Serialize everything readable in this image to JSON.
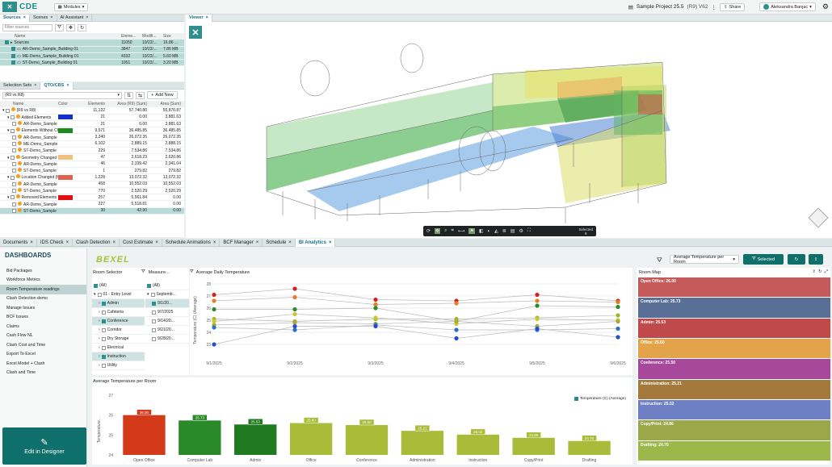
{
  "app": {
    "logo_text": "CDE",
    "modules_label": "Modules",
    "project": "Sample Project 25.5",
    "project_version": "(R9) V62",
    "share_label": "Share",
    "user": "Aleksandra Banjac"
  },
  "sources": {
    "tabs": [
      "Sources",
      "Scenes",
      "AI Assistant"
    ],
    "filter_placeholder": "Filter sources",
    "headers": [
      "Name",
      "Eleme...",
      "Modifi...",
      "Size"
    ],
    "rows": [
      {
        "name": "Sources",
        "elements": "11050",
        "modified": "10/22/...",
        "size": "16.86 ...",
        "sel": true
      },
      {
        "name": "AR-Demo_Sample_Building 01",
        "elements": "3847",
        "modified": "10/22/...",
        "size": "7.86 MB",
        "sel": true
      },
      {
        "name": "ME-Demo_Sample_Building 01",
        "elements": "4332",
        "modified": "10/22/...",
        "size": "5.60 MB",
        "sel": true
      },
      {
        "name": "ST-Demo_Sample_Building 01",
        "elements": "1051",
        "modified": "10/22/...",
        "size": "3.20 MB",
        "sel": true
      }
    ]
  },
  "selection": {
    "tabs": [
      "Selection Sets",
      "QTO/CBS"
    ],
    "version_select": "(R9 vs R8)",
    "add_new": "Add New",
    "headers": [
      "Name",
      "Color",
      "Elements",
      "Area (R9) (Sum)",
      "Area (Sum)"
    ],
    "rows": [
      {
        "name": "(R9 vs R8)",
        "color": "",
        "el": "11,122",
        "a1": "57,740.80",
        "a2": "55,870.87",
        "lvl": 0
      },
      {
        "name": "Added Elements",
        "color": "#1330c8",
        "el": "21",
        "a1": "0.00",
        "a2": "3,881.63",
        "lvl": 1
      },
      {
        "name": "AR-Demo_Sample",
        "color": "",
        "el": "21",
        "a1": "0.00",
        "a2": "3,881.63",
        "lvl": 2
      },
      {
        "name": "Elements Without Ch",
        "color": "#1c8a1c",
        "el": "9,571",
        "a1": "36,485.85",
        "a2": "36,485.85",
        "lvl": 1
      },
      {
        "name": "AR-Demo_Sample",
        "color": "",
        "el": "3,240",
        "a1": "26,072.35",
        "a2": "26,072.35",
        "lvl": 2
      },
      {
        "name": "ME-Demo_Sample",
        "color": "",
        "el": "6,102",
        "a1": "2,889.15",
        "a2": "2,888.15",
        "lvl": 2
      },
      {
        "name": "ST-Demo_Sample",
        "color": "",
        "el": "229",
        "a1": "7,534.86",
        "a2": "7,534.86",
        "lvl": 2
      },
      {
        "name": "Geometry Changed f",
        "color": "#f0c080",
        "el": "47",
        "a1": "2,618.23",
        "a2": "2,620.86",
        "lvl": 1
      },
      {
        "name": "AR-Demo_Sample",
        "color": "",
        "el": "46",
        "a1": "2,339.42",
        "a2": "2,341.04",
        "lvl": 2
      },
      {
        "name": "ST-Demo_Sample",
        "color": "",
        "el": "1",
        "a1": "279.82",
        "a2": "279.82",
        "lvl": 2
      },
      {
        "name": "Location Changed (fr",
        "color": "#e06050",
        "el": "1,228",
        "a1": "13,072.32",
        "a2": "13,072.32",
        "lvl": 1
      },
      {
        "name": "AR-Demo_Sample",
        "color": "",
        "el": "458",
        "a1": "10,552.03",
        "a2": "10,552.03",
        "lvl": 2
      },
      {
        "name": "ST-Demo_Sample",
        "color": "",
        "el": "770",
        "a1": "2,520.29",
        "a2": "2,520.29",
        "lvl": 2
      },
      {
        "name": "Removed Elements",
        "color": "#e01010",
        "el": "257",
        "a1": "5,561.84",
        "a2": "0.00",
        "lvl": 1
      },
      {
        "name": "AR-Demo_Sample",
        "color": "",
        "el": "227",
        "a1": "5,518.81",
        "a2": "0.00",
        "lvl": 2
      },
      {
        "name": "ST-Demo_Sample",
        "color": "",
        "el": "30",
        "a1": "42.90",
        "a2": "0.00",
        "lvl": 2
      }
    ]
  },
  "viewer": {
    "title": "Viewer",
    "selected_label": "Selected",
    "selected_count": "8"
  },
  "bottom_tabs": [
    "Documents",
    "IDS Check",
    "Clash Detection",
    "Cost Estimate",
    "Schedule Animations",
    "BCF Manager",
    "Schedule",
    "BI Analytics"
  ],
  "dashboards": {
    "title": "DASHBOARDS",
    "items": [
      "Bid Packages",
      "Workforce Metrics",
      "Room Temperature readings",
      "Clash Detection demo",
      "Manage Issues",
      "BCF Issues",
      "Claims",
      "Cash Flow NL",
      "Clash Cost and Time",
      "Export To Excel",
      "Excel Model + Clash",
      "Clash and Time"
    ],
    "active_index": 2,
    "edit_label": "Edit in Designer"
  },
  "bi": {
    "logo": "BEXEL",
    "measure_select": "Average Temperature per Room",
    "selected_btn": "Selected",
    "room_selector": "Room Selector",
    "measure_title": "Measure...",
    "rooms": [
      "(All)",
      "01 - Entry Level",
      "Admin",
      "Cafeteria",
      "Conference",
      "Corridor",
      "Dry Storage",
      "Electrical",
      "Instruction",
      "Utility"
    ],
    "dates": [
      "(All)",
      "Septemb...",
      "9/1/20...",
      "9/7/2025",
      "9/14/20...",
      "9/21/20...",
      "9/28/20..."
    ],
    "line_title": "Average Daily Temperature",
    "bar_title": "Average Temperature per Room",
    "bar_legend": "Temperature (C) (Average)",
    "room_map_title": "Room Map",
    "room_map": [
      {
        "label": "Open Office: 26.00",
        "color": "#c55a5a"
      },
      {
        "label": "Computer Lab: 25.73",
        "color": "#5a6f96"
      },
      {
        "label": "Admin: 25.53",
        "color": "#c04a4a"
      },
      {
        "label": "Office: 25.60",
        "color": "#e3a34a"
      },
      {
        "label": "Conference: 25.50",
        "color": "#a8489a"
      },
      {
        "label": "Administration: 25.21",
        "color": "#a47a3c"
      },
      {
        "label": "Instruction: 25.02",
        "color": "#6f7fc4"
      },
      {
        "label": "Copy/Print: 24.86",
        "color": "#9aa84a"
      },
      {
        "label": "Drafting: 24.70",
        "color": "#9cb84a"
      }
    ]
  },
  "chart_data": [
    {
      "type": "line",
      "title": "Average Daily Temperature",
      "ylabel": "Temperature (C) (Average)",
      "x": [
        "9/1/2025",
        "9/2/2025",
        "9/3/2025",
        "9/4/2025",
        "9/5/2025",
        "9/6/2025"
      ],
      "ylim": [
        22,
        28
      ],
      "series": [
        {
          "color": "#d62020",
          "values": [
            27.1,
            27.6,
            26.7,
            26.6,
            27.1,
            26.6
          ]
        },
        {
          "color": "#e08020",
          "values": [
            26.6,
            26.9,
            26.3,
            26.4,
            26.6,
            26.5
          ]
        },
        {
          "color": "#2c8a2c",
          "values": [
            25.9,
            25.9,
            26.0,
            24.9,
            26.2,
            26.1
          ]
        },
        {
          "color": "#9fb82a",
          "values": [
            25.1,
            24.9,
            25.1,
            25.1,
            25.2,
            25.4
          ]
        },
        {
          "color": "#c8c830",
          "values": [
            24.9,
            25.5,
            25.2,
            24.7,
            25.1,
            25.0
          ]
        },
        {
          "color": "#aaaa30",
          "values": [
            24.6,
            24.8,
            24.7,
            24.9,
            24.5,
            24.9
          ]
        },
        {
          "color": "#3070c0",
          "values": [
            24.4,
            24.2,
            24.6,
            24.2,
            24.2,
            24.3
          ]
        },
        {
          "color": "#2050d0",
          "values": [
            23.0,
            24.5,
            24.5,
            23.5,
            24.3,
            23.6
          ]
        }
      ]
    },
    {
      "type": "bar",
      "title": "Average Temperature per Room",
      "ylabel": "Temperature...",
      "ylim": [
        24,
        27
      ],
      "categories": [
        "Open Office",
        "Computer Lab",
        "Admin",
        "Office",
        "Conference",
        "Administration",
        "Instruction",
        "Copy/Print",
        "Drafting"
      ],
      "values": [
        26.0,
        25.73,
        25.53,
        25.6,
        25.5,
        25.21,
        25.02,
        24.86,
        24.7
      ],
      "colors": [
        "#d23a1a",
        "#2a8a2a",
        "#207a20",
        "#a8bc3a",
        "#a8bc3a",
        "#a8bc3a",
        "#a8bc3a",
        "#a8bc3a",
        "#a8bc3a"
      ]
    }
  ]
}
